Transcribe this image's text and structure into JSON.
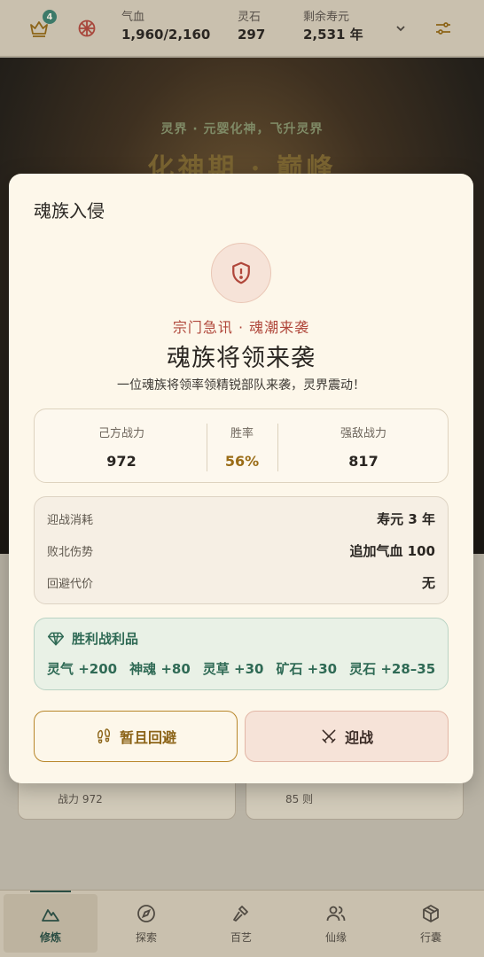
{
  "topbar": {
    "badge_count": "4",
    "stats": [
      {
        "label": "气血",
        "value": "1,960/2,160"
      },
      {
        "label": "灵石",
        "value": "297"
      },
      {
        "label": "剩余寿元",
        "value": "2,531 年"
      }
    ]
  },
  "hero": {
    "subtitle": "灵界 · 元婴化神，飞升灵界",
    "title": "化神期 · 巅峰"
  },
  "background_cards": [
    {
      "text": "战力 972"
    },
    {
      "text": "85 则"
    }
  ],
  "modal": {
    "title": "魂族入侵",
    "kicker": "宗门急讯 · 魂潮来袭",
    "headline": "魂族将领来袭",
    "description": "一位魂族将领率领精锐部队来袭，灵界震动！",
    "power": {
      "own_label": "己方战力",
      "own_value": "972",
      "rate_label": "胜率",
      "rate_value": "56%",
      "enemy_label": "强敌战力",
      "enemy_value": "817"
    },
    "costs": [
      {
        "label": "迎战消耗",
        "value": "寿元 3 年"
      },
      {
        "label": "败北伤势",
        "value": "追加气血 100"
      },
      {
        "label": "回避代价",
        "value": "无"
      }
    ],
    "loot": {
      "heading": "胜利战利品",
      "items": [
        "灵气 +200",
        "神魂 +80",
        "灵草 +30",
        "矿石 +30",
        "灵石 +28–35"
      ]
    },
    "buttons": {
      "retreat": "暂且回避",
      "fight": "迎战"
    }
  },
  "nav": {
    "items": [
      {
        "label": "修炼",
        "icon": "mountain-icon",
        "active": true
      },
      {
        "label": "探索",
        "icon": "compass-icon"
      },
      {
        "label": "百艺",
        "icon": "hammer-icon"
      },
      {
        "label": "仙缘",
        "icon": "users-icon"
      },
      {
        "label": "行囊",
        "icon": "package-icon"
      }
    ]
  },
  "colors": {
    "accent_green": "#2f6a55",
    "danger_red": "#b0473b",
    "gold": "#9a6c16",
    "modal_bg": "#fdf7ea"
  }
}
